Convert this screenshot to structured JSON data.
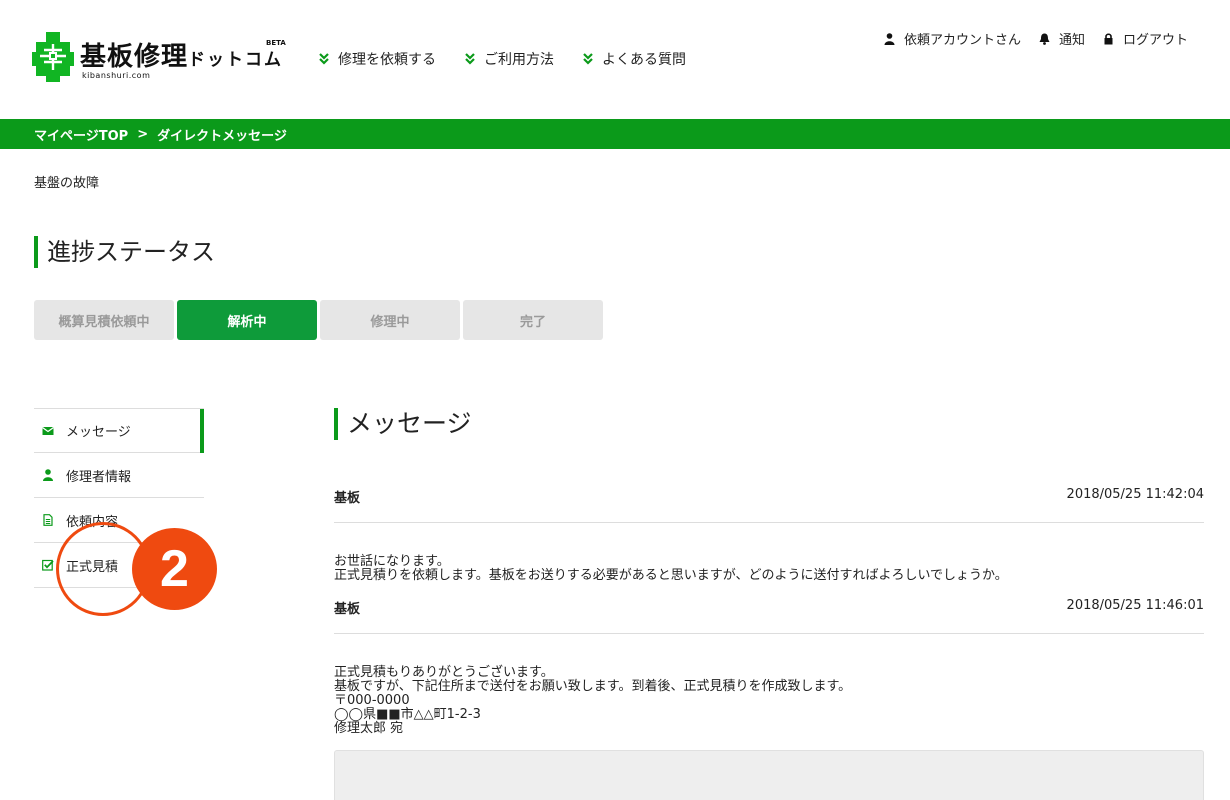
{
  "header": {
    "logo": {
      "main": "基板修理",
      "sub_small": "ドットコム",
      "beta": "BETA",
      "url_text": "kibanshuri.com"
    },
    "nav": [
      {
        "label": "修理を依頼する"
      },
      {
        "label": "ご利用方法"
      },
      {
        "label": "よくある質問"
      }
    ],
    "user_nav": [
      {
        "label": "依頼アカウントさん",
        "icon": "user-icon"
      },
      {
        "label": "通知",
        "icon": "bell-icon"
      },
      {
        "label": "ログアウト",
        "icon": "lock-icon"
      }
    ]
  },
  "breadcrumb": {
    "home": "マイページTOP",
    "separator": ">",
    "current": "ダイレクトメッセージ"
  },
  "case_title": "基盤の故障",
  "status": {
    "title": "進捗ステータス",
    "steps": [
      {
        "label": "概算見積依頼中",
        "active": false
      },
      {
        "label": "解析中",
        "active": true
      },
      {
        "label": "修理中",
        "active": false
      },
      {
        "label": "完了",
        "active": false
      }
    ]
  },
  "sidemenu": {
    "items": [
      {
        "label": "メッセージ",
        "icon": "envelope-icon",
        "active": true
      },
      {
        "label": "修理者情報",
        "icon": "user-icon",
        "active": false
      },
      {
        "label": "依頼内容",
        "icon": "document-icon",
        "active": false
      },
      {
        "label": "正式見積",
        "icon": "checkbox-icon",
        "active": false
      }
    ]
  },
  "annotation": {
    "number": "2"
  },
  "messages": {
    "title": "メッセージ",
    "items": [
      {
        "sender": "基板",
        "time": "2018/05/25 11:42:04",
        "body": "お世話になります。\n正式見積りを依頼します。基板をお送りする必要があると思いますが、どのように送付すればよろしいでしょうか。"
      },
      {
        "sender": "基板",
        "time": "2018/05/25 11:46:01",
        "body": "正式見積もりありがとうございます。\n基板ですが、下記住所まで送付をお願い致します。到着後、正式見積りを作成致します。\n〒000-0000\n◯◯県■■市△△町1-2-3\n修理太郎 宛"
      }
    ]
  },
  "colors": {
    "brand_green": "#0b9a1a",
    "step_active": "#0e9b3a",
    "annotation_orange": "#ef4a10"
  }
}
